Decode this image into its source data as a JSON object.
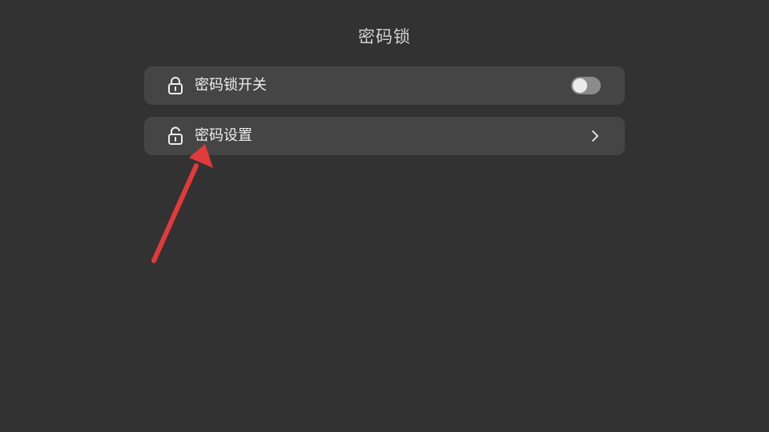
{
  "header": {
    "title": "密码锁"
  },
  "settings": {
    "rows": [
      {
        "label": "密码锁开关",
        "icon": "lock-icon",
        "control": "toggle",
        "enabled": false
      },
      {
        "label": "密码设置",
        "icon": "unlock-icon",
        "control": "chevron-right-icon"
      }
    ]
  },
  "annotation": {
    "icon": "red-arrow-icon",
    "color": "#e23a3a"
  },
  "colors": {
    "background": "#323232",
    "row": "#454545",
    "text": "#ededed"
  }
}
